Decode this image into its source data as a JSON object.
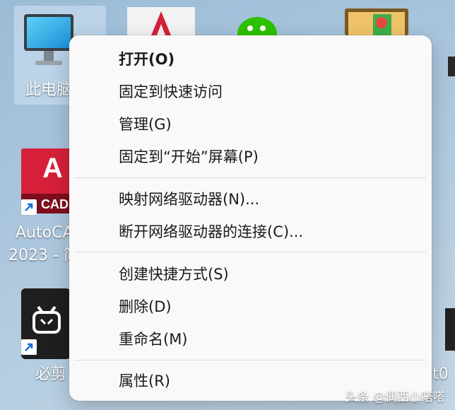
{
  "desktop": {
    "this_pc_label": "此电脑",
    "autocad_label_line1": "AutoCAD",
    "autocad_label_line2": "2023 - 简",
    "autocad_icon_letter": "A",
    "autocad_icon_sub": "CAD",
    "bijian_label": "必剪",
    "right_label_fragment": "t0",
    "colors": {
      "autocad_red": "#d6203a",
      "wechat_green": "#2dc100",
      "bijian_dark": "#1f1f1f"
    }
  },
  "context_menu": {
    "items": [
      {
        "label": "打开(O)"
      },
      {
        "label": "固定到快速访问"
      },
      {
        "label": "管理(G)"
      },
      {
        "label": "固定到“开始”屏幕(P)"
      },
      {
        "label": "映射网络驱动器(N)..."
      },
      {
        "label": "断开网络驱动器的连接(C)..."
      },
      {
        "label": "创建快捷方式(S)"
      },
      {
        "label": "删除(D)"
      },
      {
        "label": "重命名(M)"
      },
      {
        "label": "属性(R)"
      }
    ]
  },
  "watermark": "头条 @偶西小嗒嗒"
}
